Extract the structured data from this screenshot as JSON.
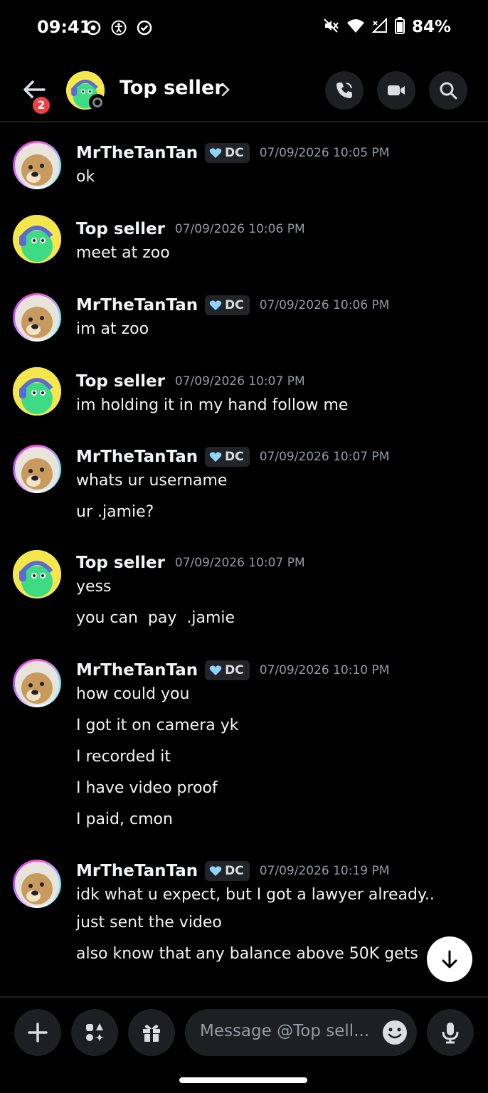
{
  "status": {
    "time": "09:41",
    "battery": "84%"
  },
  "header": {
    "title": "Top seller",
    "unread_badge": "2"
  },
  "tag": {
    "label": "DC"
  },
  "messages": [
    {
      "author": "MrTheTanTan",
      "timestamp": "07/09/2026 10:05 PM",
      "lines": [
        "ok"
      ]
    },
    {
      "author": "Top seller",
      "timestamp": "07/09/2026 10:06 PM",
      "lines": [
        "meet at zoo"
      ]
    },
    {
      "author": "MrTheTanTan",
      "timestamp": "07/09/2026 10:06 PM",
      "lines": [
        "im at zoo"
      ]
    },
    {
      "author": "Top seller",
      "timestamp": "07/09/2026 10:07 PM",
      "lines": [
        "im holding it in my hand follow me"
      ]
    },
    {
      "author": "MrTheTanTan",
      "timestamp": "07/09/2026 10:07 PM",
      "lines": [
        "whats ur username",
        "ur .jamie?"
      ]
    },
    {
      "author": "Top seller",
      "timestamp": "07/09/2026 10:07 PM",
      "lines": [
        "yess",
        "you can  pay  .jamie"
      ]
    },
    {
      "author": "MrTheTanTan",
      "timestamp": "07/09/2026 10:10 PM",
      "lines": [
        "how could you",
        "I got it on camera yk",
        "I recorded it",
        "I have video proof",
        "I paid, cmon"
      ]
    },
    {
      "author": "MrTheTanTan",
      "timestamp": "07/09/2026 10:19 PM",
      "lines": [
        "idk what u expect, but I got a lawyer already..",
        "just sent the video",
        "also know that any balance above 50K gets"
      ]
    }
  ],
  "composer": {
    "placeholder": "Message @Top sell..."
  },
  "icons": {
    "back": "arrow-left-icon",
    "call": "phone-icon",
    "video": "video-camera-icon",
    "search": "search-icon",
    "plus": "plus-icon",
    "apps": "apps-icon",
    "gift": "gift-icon",
    "emoji": "emoji-icon",
    "mic": "microphone-icon",
    "scroll": "arrow-down-icon"
  },
  "colors": {
    "background": "#000000",
    "badge": "#f23f43",
    "timestamp": "#949ba4",
    "surface": "#1e1f22"
  }
}
